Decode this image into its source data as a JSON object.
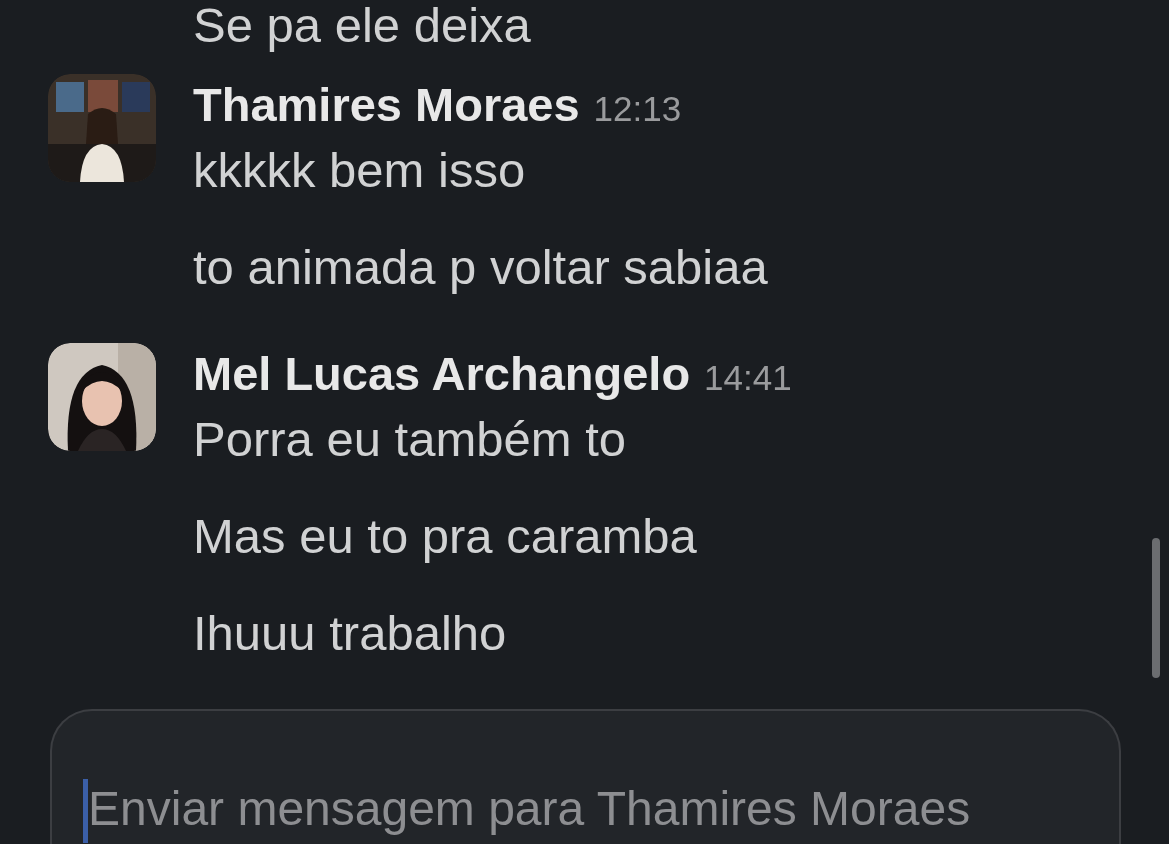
{
  "previous_message": "Se pa ele deixa",
  "messages": [
    {
      "author": "Thamires Moraes",
      "time": "12:13",
      "lines": [
        "kkkkk bem isso",
        "to animada p voltar sabiaa"
      ]
    },
    {
      "author": "Mel Lucas Archangelo",
      "time": "14:41",
      "lines": [
        "Porra eu também to",
        "Mas eu to pra caramba",
        "Ihuuu trabalho"
      ]
    }
  ],
  "composer": {
    "placeholder": "Enviar mensagem para Thamires Moraes"
  }
}
